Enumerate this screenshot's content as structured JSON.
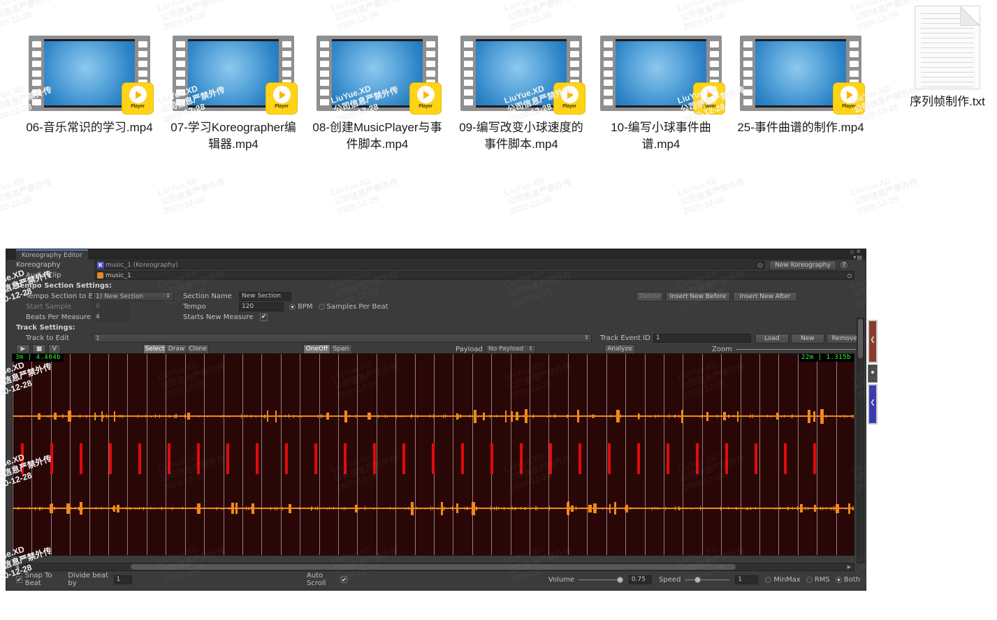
{
  "files": [
    {
      "name": "06-音乐常识的学习.mp4",
      "icon": "video-file-icon",
      "badge": "Player"
    },
    {
      "name": "07-学习Koreographer编辑器.mp4",
      "icon": "video-file-icon",
      "badge": "Player"
    },
    {
      "name": "08-创建MusicPlayer与事件脚本.mp4",
      "icon": "video-file-icon",
      "badge": "Player"
    },
    {
      "name": "09-编写改变小球速度的事件脚本.mp4",
      "icon": "video-file-icon",
      "badge": "Player"
    },
    {
      "name": "10-编写小球事件曲谱.mp4",
      "icon": "video-file-icon",
      "badge": "Player"
    },
    {
      "name": "25-事件曲谱的制作.mp4",
      "icon": "video-file-icon",
      "badge": "Player"
    },
    {
      "name": "序列帧制作.txt",
      "icon": "text-file-icon",
      "badge": ""
    }
  ],
  "watermark": {
    "line1": "LiuYue.XD",
    "line2": "公司信息严禁外传",
    "line3": "2020-12-28"
  },
  "editor": {
    "tab_label": "Koreography Editor",
    "window_controls": {
      "minimize": "▫",
      "close": "✕",
      "menu": "▾▤"
    },
    "koreography": {
      "label": "Koreography",
      "value": "music_1 (Koreography)",
      "new_button": "New Koreography",
      "help_button": "?"
    },
    "audio_clip": {
      "label": "Audio Clip",
      "value": "music_1"
    },
    "tempo_header": "Tempo Section Settings:",
    "tempo_section_to_edit": {
      "label": "Tempo Section to Edit",
      "value": "1) New Section"
    },
    "section_name": {
      "label": "Section Name",
      "value": "New Section"
    },
    "start_sample": {
      "label": "Start Sample",
      "value": "0"
    },
    "tempo": {
      "label": "Tempo",
      "value": "120"
    },
    "bpm_radio": "BPM",
    "samples_per_beat_radio": "Samples Per Beat",
    "beats_per_measure": {
      "label": "Beats Per Measure",
      "value": "4"
    },
    "starts_new_measure": {
      "label": "Starts New Measure",
      "checked": "✔"
    },
    "section_buttons": {
      "delete": "Delete",
      "insert_before": "Insert New Before",
      "insert_after": "Insert New After"
    },
    "track_header": "Track Settings:",
    "track_to_edit": {
      "label": "Track to Edit",
      "value": "1"
    },
    "track_event_id": {
      "label": "Track Event ID",
      "value": "1"
    },
    "track_buttons": {
      "load": "Load",
      "new": "New",
      "remove": "Remove"
    },
    "transport": {
      "play": "▶",
      "stop": "■",
      "loop": "V"
    },
    "edit_modes": [
      "Select",
      "Draw",
      "Clone"
    ],
    "edit_mode_active": "Select",
    "span_modes": [
      "OneOff",
      "Span"
    ],
    "span_mode_active": "OneOff",
    "payload": {
      "label": "Payload",
      "value": "No Payload"
    },
    "analyze_button": "Analyze",
    "zoom": {
      "label": "Zoom"
    },
    "timeline": {
      "left_marker": "3m | 4.404b",
      "right_marker": "22m | 1.315b"
    },
    "status": {
      "snap_to_beat": {
        "label": "Snap To Beat",
        "checked": "✔"
      },
      "divide_beat_by": {
        "label": "Divide beat by",
        "value": "1"
      },
      "auto_scroll": {
        "label": "Auto Scroll",
        "checked": "✔"
      },
      "volume": {
        "label": "Volume",
        "value": "0.75"
      },
      "speed": {
        "label": "Speed",
        "value": "1"
      },
      "display_modes": [
        "MinMax",
        "RMS",
        "Both"
      ],
      "display_mode_active": "Both"
    },
    "colors": {
      "waveform": "#f08a1a",
      "event_marker": "#e00b0b",
      "wave_background": "#2a0707",
      "timeline_text": "#2dff2d",
      "panel_background": "#3b3b3b",
      "tab_accent": "#4f7fbf"
    }
  }
}
